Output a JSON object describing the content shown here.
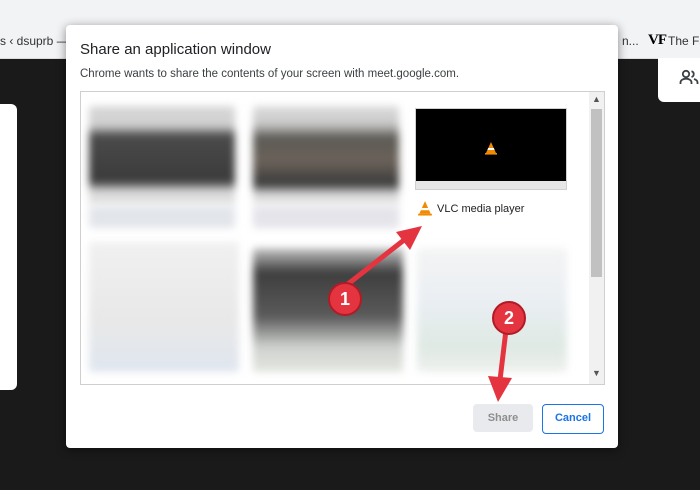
{
  "browser": {
    "bookmark_left": "s ‹ dsuprb — |",
    "bookmark_right": "n...",
    "bookmark_vf_logo": "VF",
    "bookmark_fa": "The Fa"
  },
  "dialog": {
    "title": "Share an application window",
    "subtitle": "Chrome wants to share the contents of your screen with meet.google.com.",
    "windows": [
      {
        "name": "VLC media player",
        "icon": "vlc-cone-icon"
      }
    ],
    "share_label": "Share",
    "cancel_label": "Cancel"
  },
  "annotations": {
    "step1": "1",
    "step2": "2"
  },
  "colors": {
    "badge_red": "#e4343f",
    "primary_blue": "#1a73e8"
  }
}
